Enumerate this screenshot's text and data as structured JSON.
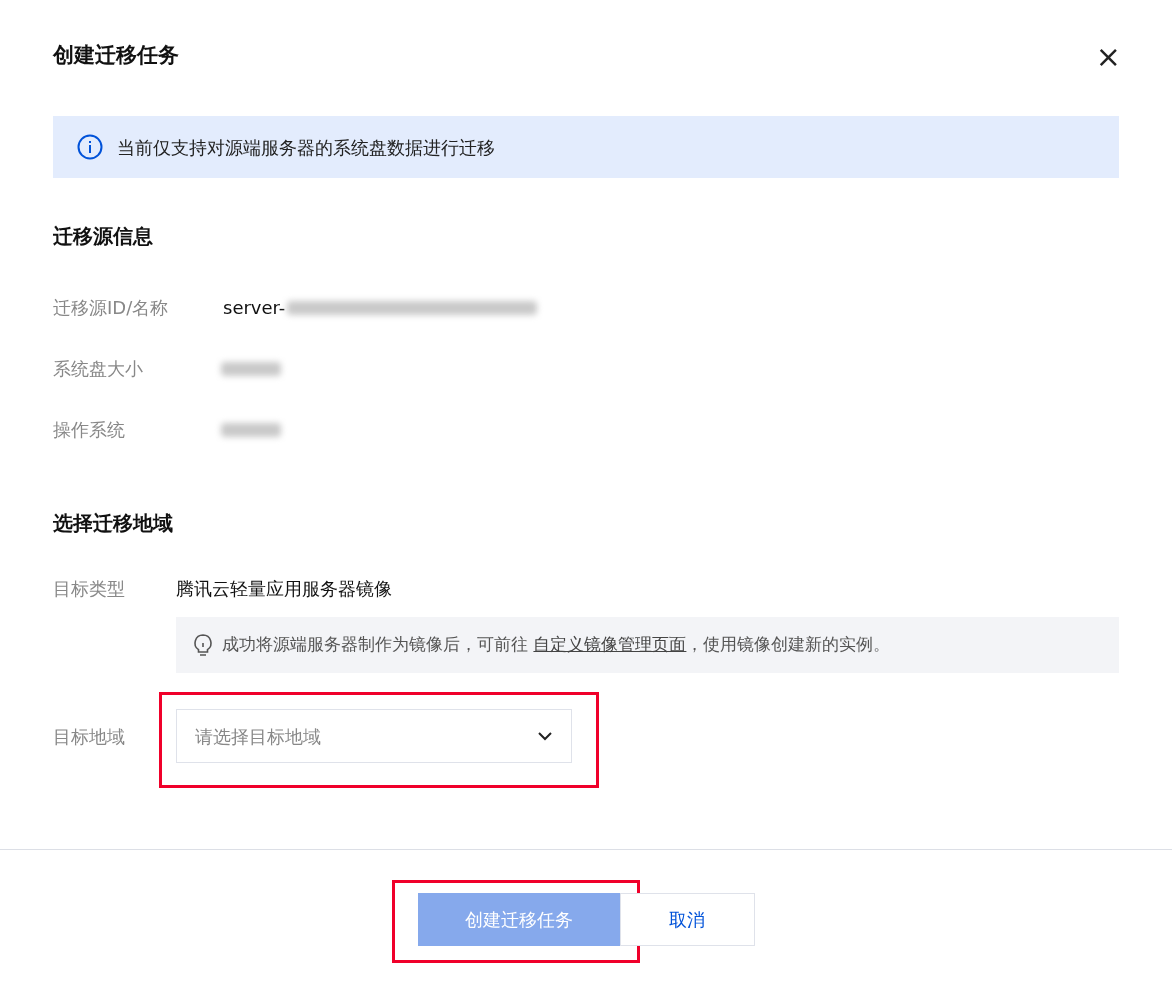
{
  "dialog": {
    "title": "创建迁移任务",
    "close": "×"
  },
  "notice": {
    "text": "当前仅支持对源端服务器的系统盘数据进行迁移"
  },
  "source_section": {
    "heading": "迁移源信息",
    "rows": [
      {
        "label": "迁移源ID/名称",
        "value": "server-",
        "redacted": true
      },
      {
        "label": "系统盘大小",
        "redacted": true
      },
      {
        "label": "操作系统",
        "redacted": true
      }
    ]
  },
  "region_section": {
    "heading": "选择迁移地域",
    "target_type": {
      "label": "目标类型",
      "value": "腾讯云轻量应用服务器镜像"
    },
    "tip": {
      "before": "成功将源端服务器制作为镜像后，可前往 ",
      "link": "自定义镜像管理页面",
      "after": "，使用镜像创建新的实例。"
    },
    "target_region": {
      "label": "目标地域",
      "placeholder": "请选择目标地域",
      "highlighted": true
    }
  },
  "footer": {
    "buttons": [
      {
        "label": "创建迁移任务",
        "kind": "primary",
        "disabled": true,
        "highlighted": true
      },
      {
        "label": "取消",
        "kind": "secondary",
        "disabled": false,
        "highlighted": false
      }
    ]
  }
}
